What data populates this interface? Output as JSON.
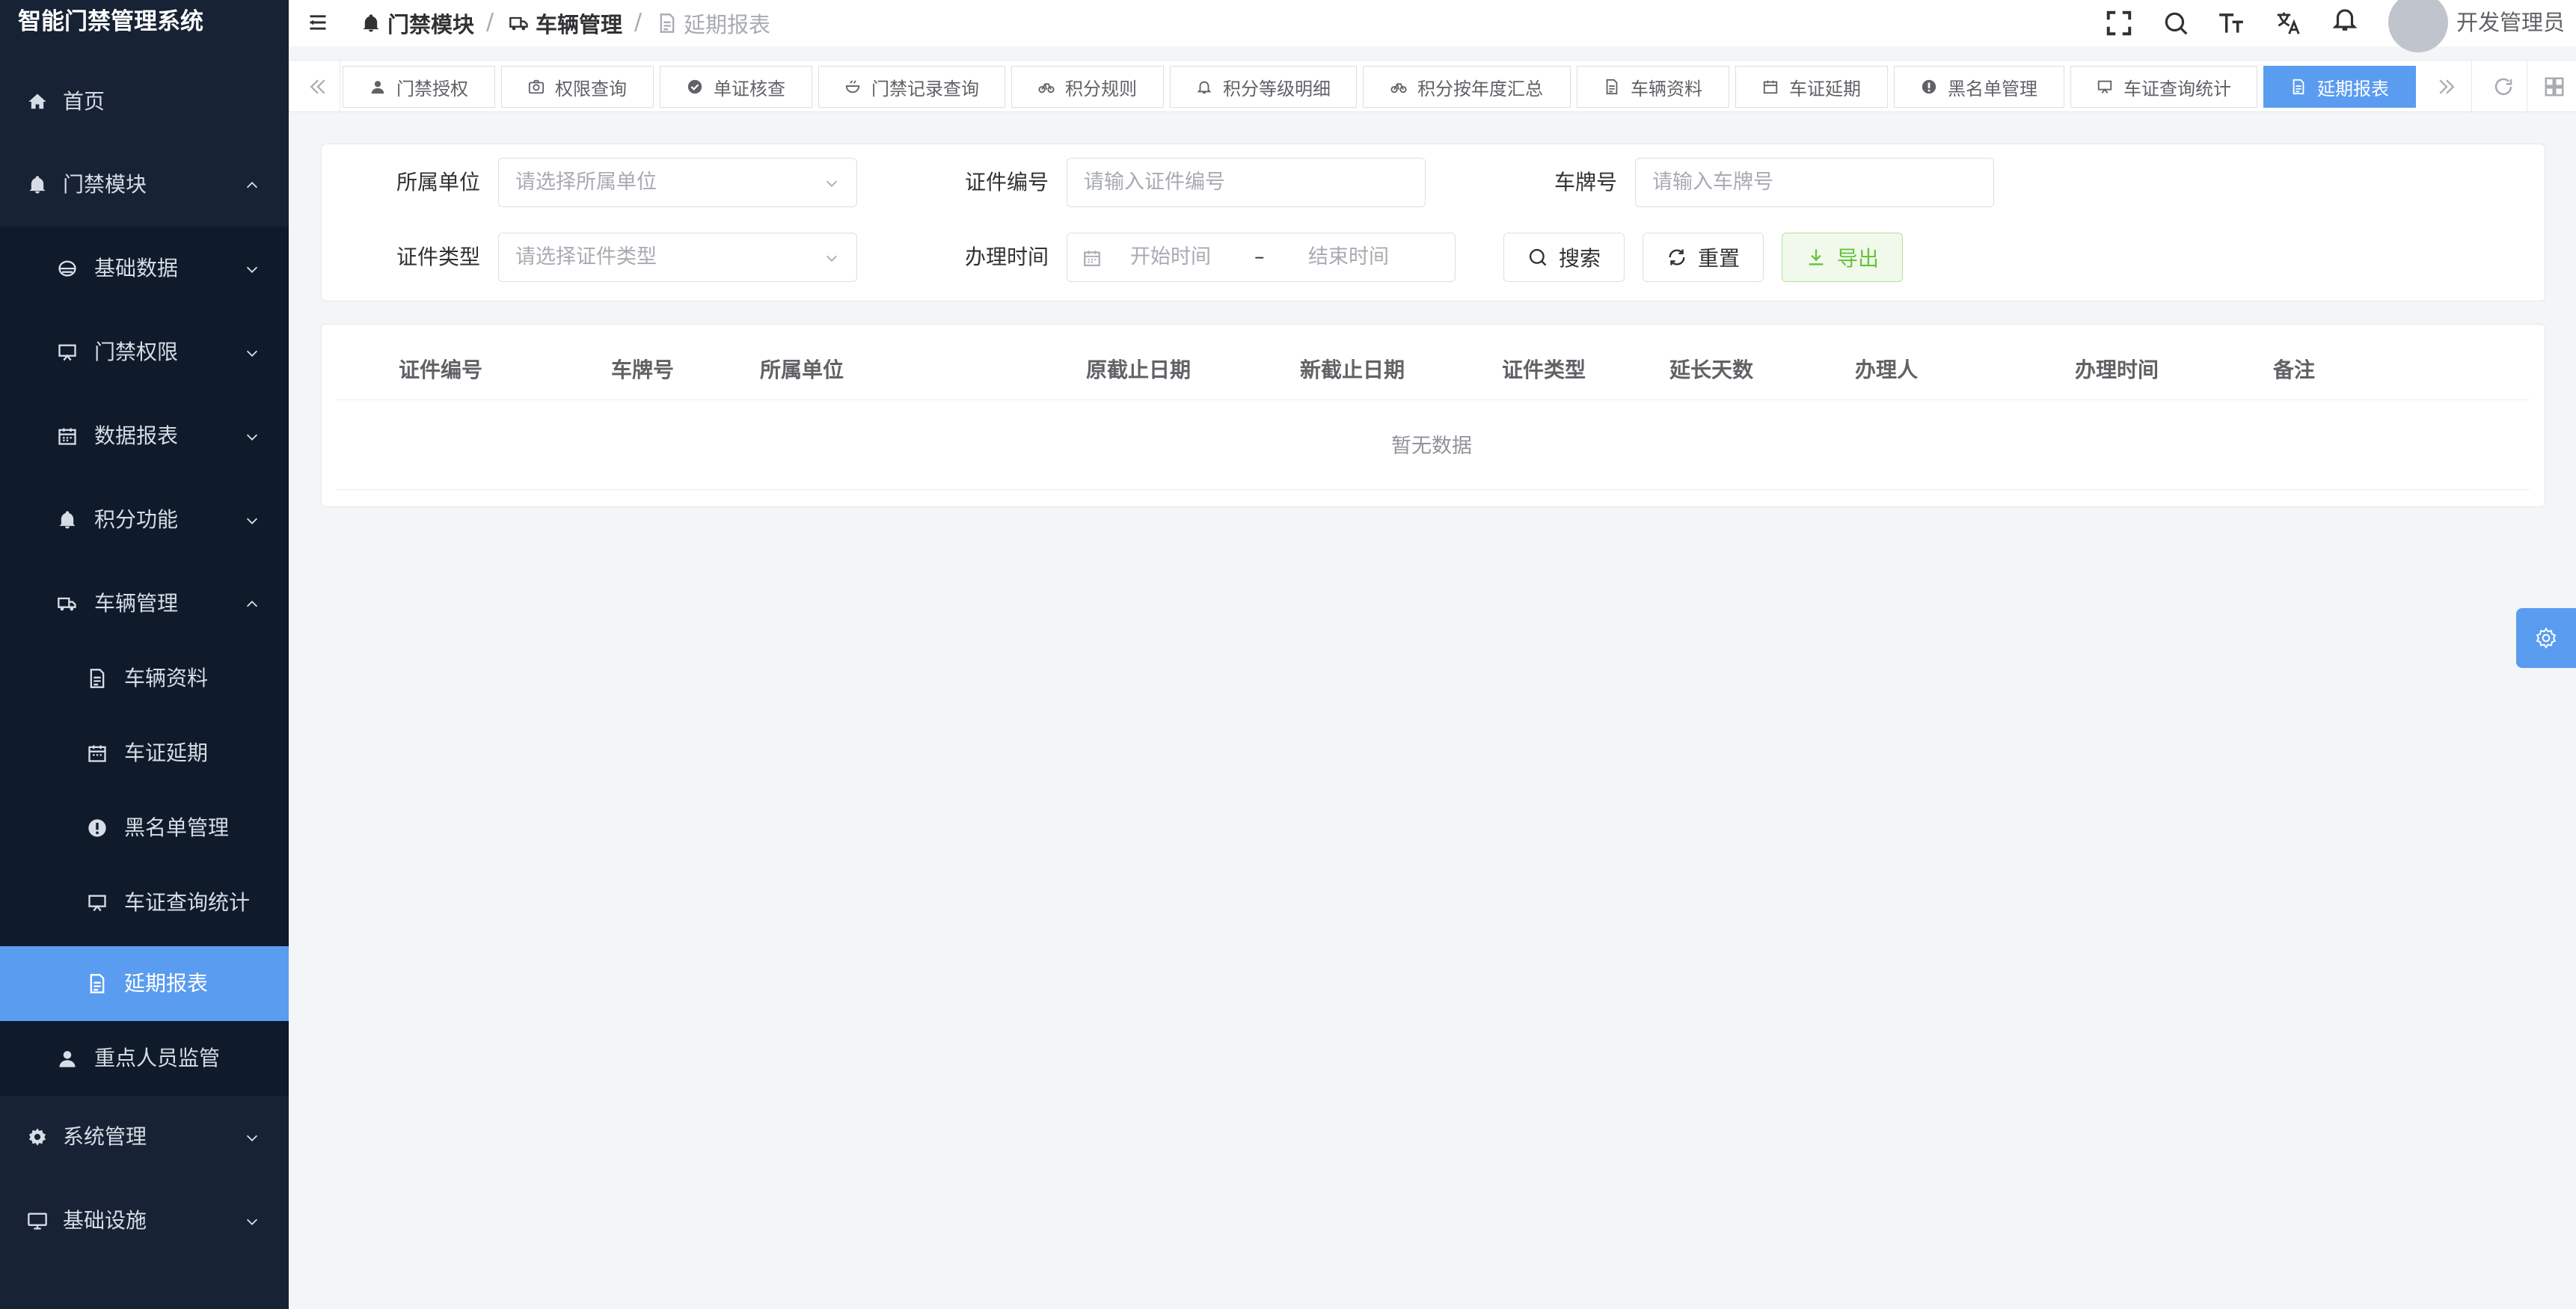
{
  "app": {
    "title": "智能门禁管理系统"
  },
  "sidebar": {
    "items": [
      {
        "label": "首页",
        "icon": "home-icon"
      },
      {
        "label": "门禁模块",
        "icon": "bell-icon",
        "expanded": true
      },
      {
        "label": "基础数据",
        "icon": "database-icon"
      },
      {
        "label": "门禁权限",
        "icon": "monitor-icon"
      },
      {
        "label": "数据报表",
        "icon": "calendar-icon"
      },
      {
        "label": "积分功能",
        "icon": "bell-icon"
      },
      {
        "label": "车辆管理",
        "icon": "truck-icon",
        "expanded": true
      },
      {
        "label": "车辆资料",
        "icon": "document-icon"
      },
      {
        "label": "车证延期",
        "icon": "calendar-icon"
      },
      {
        "label": "黑名单管理",
        "icon": "warning-icon"
      },
      {
        "label": "车证查询统计",
        "icon": "monitor-icon"
      },
      {
        "label": "延期报表",
        "icon": "document-icon",
        "active": true
      },
      {
        "label": "重点人员监管",
        "icon": "user-icon"
      },
      {
        "label": "系统管理",
        "icon": "gear-icon"
      },
      {
        "label": "基础设施",
        "icon": "monitor-icon"
      }
    ]
  },
  "header": {
    "breadcrumb": [
      "门禁模块",
      "车辆管理",
      "延期报表"
    ],
    "username": "开发管理员"
  },
  "tags": [
    {
      "label": "门禁授权",
      "icon": "user-icon"
    },
    {
      "label": "权限查询",
      "icon": "camera-icon"
    },
    {
      "label": "单证核查",
      "icon": "check-circle-icon"
    },
    {
      "label": "门禁记录查询",
      "icon": "bowl-icon"
    },
    {
      "label": "积分规则",
      "icon": "bicycle-icon"
    },
    {
      "label": "积分等级明细",
      "icon": "bell-icon"
    },
    {
      "label": "积分按年度汇总",
      "icon": "bicycle-icon"
    },
    {
      "label": "车辆资料",
      "icon": "document-icon"
    },
    {
      "label": "车证延期",
      "icon": "calendar-icon"
    },
    {
      "label": "黑名单管理",
      "icon": "warning-icon"
    },
    {
      "label": "车证查询统计",
      "icon": "monitor-icon"
    },
    {
      "label": "延期报表",
      "icon": "document-icon",
      "active": true
    }
  ],
  "search": {
    "unit_label": "所属单位",
    "unit_placeholder": "请选择所属单位",
    "cert_no_label": "证件编号",
    "cert_no_placeholder": "请输入证件编号",
    "plate_label": "车牌号",
    "plate_placeholder": "请输入车牌号",
    "cert_type_label": "证件类型",
    "cert_type_placeholder": "请选择证件类型",
    "time_label": "办理时间",
    "start_placeholder": "开始时间",
    "range_separator": "–",
    "end_placeholder": "结束时间",
    "search_button": "搜索",
    "reset_button": "重置",
    "export_button": "导出"
  },
  "table": {
    "columns": [
      "证件编号",
      "车牌号",
      "所属单位",
      "原截止日期",
      "新截止日期",
      "证件类型",
      "延长天数",
      "办理人",
      "办理时间",
      "备注"
    ],
    "empty_text": "暂无数据"
  },
  "colors": {
    "sidebar_bg": "#172234",
    "sidebar_sub_bg": "#0f1a2a",
    "accent": "#5a9cf0",
    "export_green": "#67c23a"
  }
}
